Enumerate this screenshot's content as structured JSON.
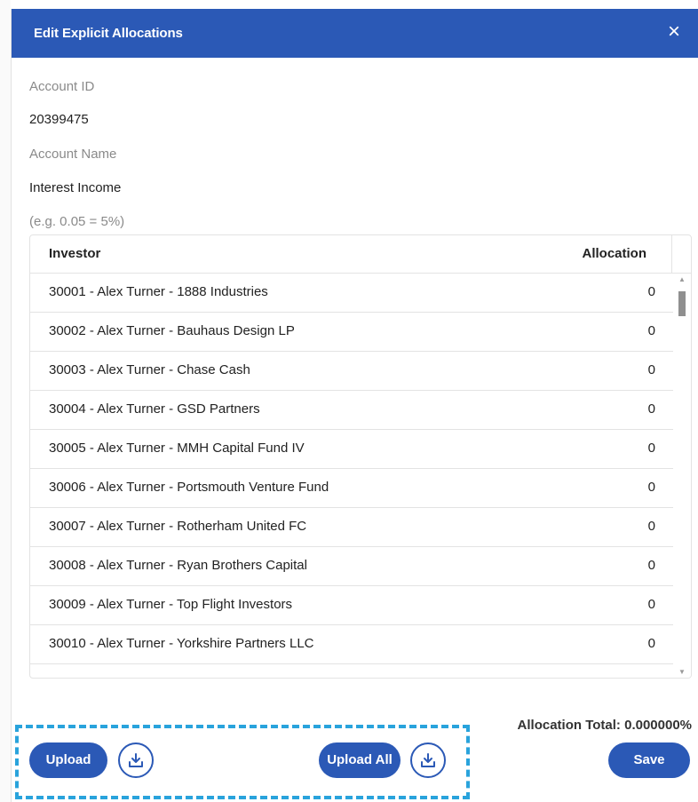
{
  "modal": {
    "title": "Edit Explicit Allocations",
    "close_icon": "×"
  },
  "fields": {
    "account_id_label": "Account ID",
    "account_id_value": "20399475",
    "account_name_label": "Account Name",
    "account_name_value": "Interest Income",
    "hint": "(e.g. 0.05 = 5%)"
  },
  "grid": {
    "columns": [
      "Investor",
      "Allocation"
    ],
    "rows": [
      {
        "investor": "30001 - Alex Turner - 1888 Industries",
        "allocation": "0"
      },
      {
        "investor": "30002 - Alex Turner - Bauhaus Design LP",
        "allocation": "0"
      },
      {
        "investor": "30003 - Alex Turner - Chase Cash",
        "allocation": "0"
      },
      {
        "investor": "30004 - Alex Turner - GSD Partners",
        "allocation": "0"
      },
      {
        "investor": "30005 - Alex Turner - MMH Capital Fund IV",
        "allocation": "0"
      },
      {
        "investor": "30006 - Alex Turner - Portsmouth Venture Fund",
        "allocation": "0"
      },
      {
        "investor": "30007 - Alex Turner - Rotherham United FC",
        "allocation": "0"
      },
      {
        "investor": "30008 - Alex Turner - Ryan Brothers Capital",
        "allocation": "0"
      },
      {
        "investor": "30009 - Alex Turner - Top Flight Investors",
        "allocation": "0"
      },
      {
        "investor": "30010 - Alex Turner - Yorkshire Partners LLC",
        "allocation": "0"
      }
    ]
  },
  "footer": {
    "allocation_total": "Allocation Total: 0.000000%",
    "upload_label": "Upload",
    "upload_all_label": "Upload All",
    "save_label": "Save",
    "download_icon": "download-icon"
  },
  "colors": {
    "header": "#2b59b6",
    "button": "#2b59b6",
    "highlight_dash": "#29a3dc"
  }
}
